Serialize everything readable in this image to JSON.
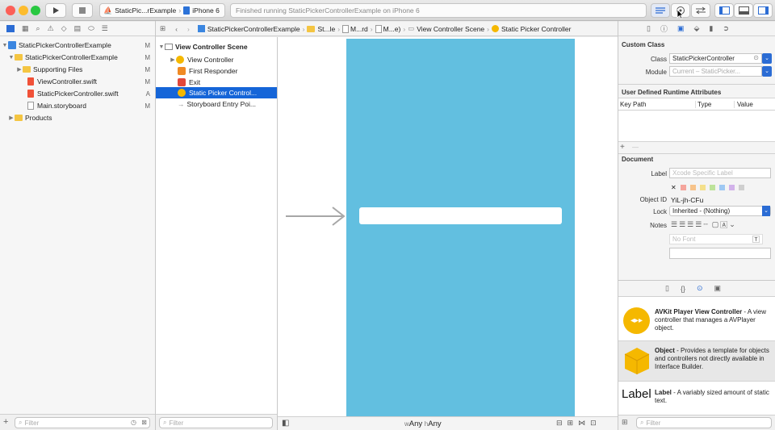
{
  "toolbar": {
    "scheme": "StaticPic...rExample",
    "device": "iPhone 6",
    "activity": "Finished running StaticPickerControllerExample on iPhone 6"
  },
  "colors": {
    "accent": "#1e64d6",
    "canvas_view": "#62bfe0",
    "selection": "#1565d8"
  },
  "navigator": {
    "items": [
      {
        "label": "StaticPickerControllerExample",
        "status": "M"
      },
      {
        "label": "StaticPickerControllerExample",
        "status": "M"
      },
      {
        "label": "Supporting Files",
        "status": "M"
      },
      {
        "label": "ViewController.swift",
        "status": "M"
      },
      {
        "label": "StaticPickerController.swift",
        "status": "A"
      },
      {
        "label": "Main.storyboard",
        "status": "M"
      },
      {
        "label": "Products",
        "status": ""
      }
    ],
    "filter_placeholder": "Filter"
  },
  "jumpbar": {
    "crumbs": [
      "StaticPickerControllerExample",
      "St...le",
      "M...rd",
      "M...e)",
      "View Controller Scene",
      "Static Picker Controller"
    ]
  },
  "outline": {
    "scene": "View Controller Scene",
    "items": [
      "View Controller",
      "First Responder",
      "Exit",
      "Static Picker Control...",
      "Storyboard Entry Poi..."
    ],
    "filter_placeholder": "Filter"
  },
  "canvas": {
    "size_w": "w",
    "size_w_val": "Any",
    "size_h": "h",
    "size_h_val": "Any"
  },
  "inspector": {
    "custom_class_title": "Custom Class",
    "class_label": "Class",
    "class_value": "StaticPickerController",
    "module_label": "Module",
    "module_placeholder": "Current – StaticPicker...",
    "udra_title": "User Defined Runtime Attributes",
    "col_keypath": "Key Path",
    "col_type": "Type",
    "col_value": "Value",
    "plus": "+",
    "minus": "—",
    "document_title": "Document",
    "label_label": "Label",
    "label_placeholder": "Xcode Specific Label",
    "objectid_label": "Object ID",
    "objectid_value": "YiL-jh-CFu",
    "lock_label": "Lock",
    "lock_value": "Inherited - (Nothing)",
    "notes_label": "Notes",
    "font_placeholder": "No Font"
  },
  "library": {
    "items": [
      {
        "title": "AVKit Player View Controller",
        "desc": " - A view controller that manages a AVPlayer object."
      },
      {
        "title": "Object",
        "desc": " - Provides a template for objects and controllers not directly available in Interface Builder."
      },
      {
        "title": "Label",
        "desc": " - A variably sized amount of static text.",
        "icon_text": "Label"
      }
    ],
    "filter_placeholder": "Filter"
  }
}
